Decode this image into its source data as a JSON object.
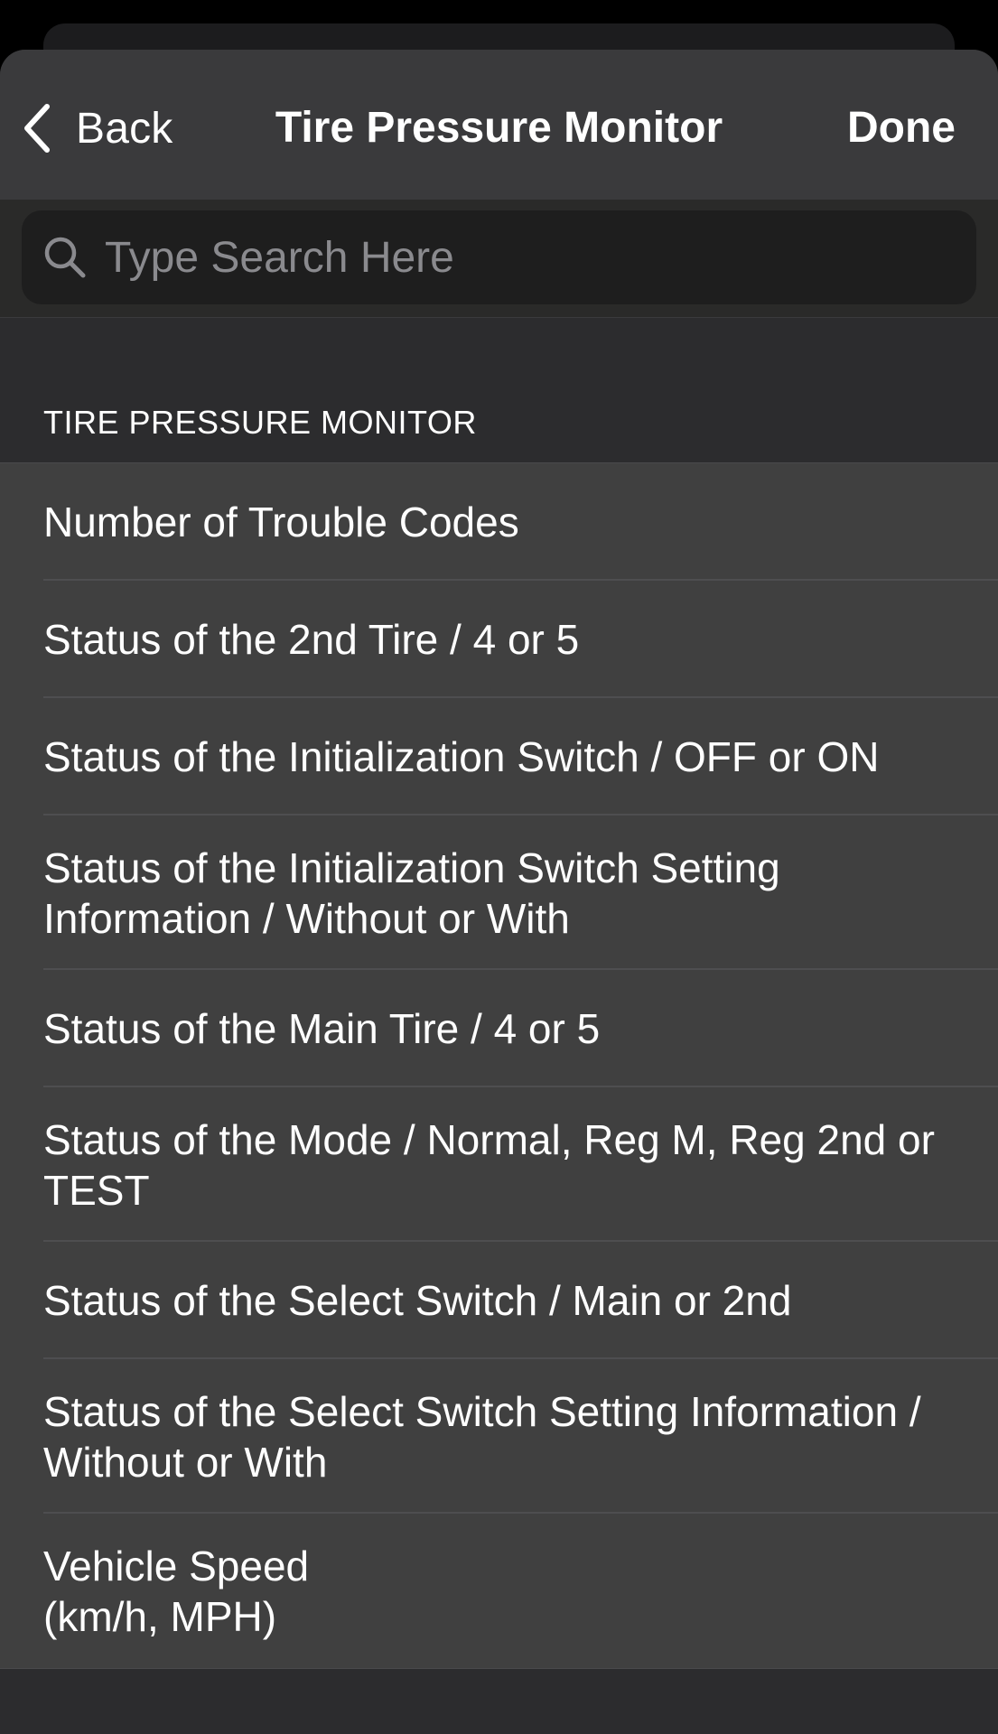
{
  "navbar": {
    "back_label": "Back",
    "title": "Tire Pressure Monitor",
    "done_label": "Done"
  },
  "search": {
    "placeholder": "Type Search Here",
    "value": ""
  },
  "section": {
    "header": "TIRE PRESSURE MONITOR"
  },
  "items": [
    {
      "label": "Number of Trouble Codes"
    },
    {
      "label": "Status of the 2nd Tire / 4 or 5"
    },
    {
      "label": "Status of the Initialization Switch / OFF or ON"
    },
    {
      "label": "Status of the Initialization Switch Setting Information / Without or With"
    },
    {
      "label": "Status of the Main Tire / 4 or 5"
    },
    {
      "label": "Status of the Mode / Normal, Reg M, Reg 2nd or TEST"
    },
    {
      "label": "Status of the Select Switch / Main or 2nd"
    },
    {
      "label": "Status of the Select Switch Setting Information / Without or With"
    },
    {
      "label": "Vehicle Speed\n(km/h, MPH)"
    }
  ],
  "icons": {
    "back": "chevron-left-icon",
    "search": "magnifying-glass-icon"
  },
  "colors": {
    "sheet_background": "#2c2c2e",
    "navbar_background": "#3a3a3c",
    "row_background": "#404040",
    "text": "#ffffff",
    "placeholder": "#8a8a8e"
  }
}
